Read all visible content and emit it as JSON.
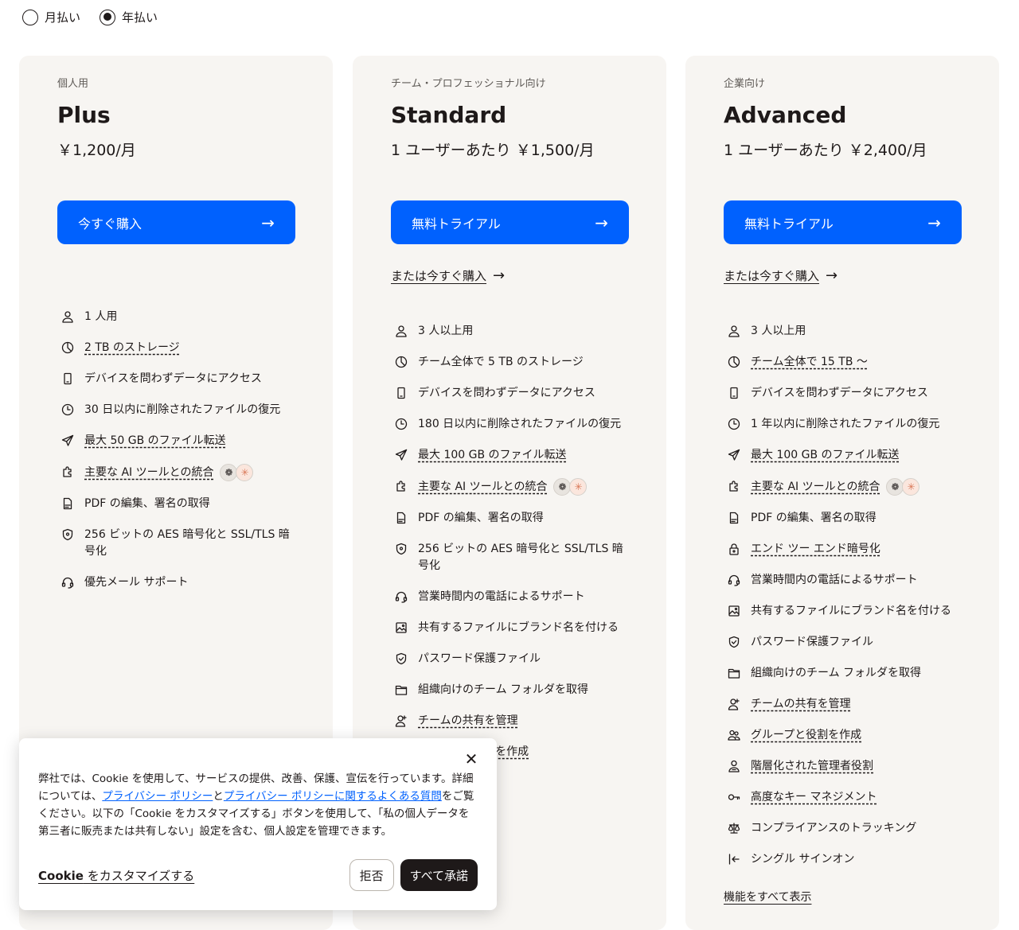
{
  "billing": {
    "monthly_label": "月払い",
    "annual_label": "年払い",
    "selected": "annual"
  },
  "plans": [
    {
      "eyebrow": "個人用",
      "name": "Plus",
      "price": "￥1,200/月",
      "cta": "今すぐ購入",
      "buy_link": "",
      "features": [
        {
          "icon": "person-icon",
          "text": "1 人用",
          "link": false
        },
        {
          "icon": "pie-chart-icon",
          "text": "2 TB のストレージ",
          "link": true
        },
        {
          "icon": "mobile-device-icon",
          "text": "デバイスを問わずデータにアクセス",
          "link": false
        },
        {
          "icon": "clock-icon",
          "text": "30 日以内に削除されたファイルの復元",
          "link": false
        },
        {
          "icon": "paper-plane-icon",
          "text": "最大 50 GB のファイル転送",
          "link": true
        },
        {
          "icon": "puzzle-icon",
          "text": "主要な AI ツールとの統合",
          "link": true,
          "ai": true
        },
        {
          "icon": "pdf-icon",
          "text": "PDF の編集、署名の取得",
          "link": false
        },
        {
          "icon": "shield-icon",
          "text": "256 ビットの AES 暗号化と SSL/TLS 暗号化",
          "link": false
        },
        {
          "icon": "headset-icon",
          "text": "優先メール サポート",
          "link": false
        }
      ]
    },
    {
      "eyebrow": "チーム・プロフェッショナル向け",
      "name": "Standard",
      "price": "1 ユーザーあたり ￥1,500/月",
      "cta": "無料トライアル",
      "buy_link": "または今すぐ購入",
      "features": [
        {
          "icon": "person-icon",
          "text": "3 人以上用",
          "link": false
        },
        {
          "icon": "pie-chart-icon",
          "text": "チーム全体で 5 TB のストレージ",
          "link": false
        },
        {
          "icon": "mobile-device-icon",
          "text": "デバイスを問わずデータにアクセス",
          "link": false
        },
        {
          "icon": "clock-icon",
          "text": "180 日以内に削除されたファイルの復元",
          "link": false
        },
        {
          "icon": "paper-plane-icon",
          "text": "最大 100 GB のファイル転送",
          "link": true
        },
        {
          "icon": "puzzle-icon",
          "text": "主要な AI ツールとの統合",
          "link": true,
          "ai": true
        },
        {
          "icon": "pdf-icon",
          "text": "PDF の編集、署名の取得",
          "link": false
        },
        {
          "icon": "shield-icon",
          "text": "256 ビットの AES 暗号化と SSL/TLS 暗号化",
          "link": false
        },
        {
          "icon": "headset-icon",
          "text": "営業時間内の電話によるサポート",
          "link": false
        },
        {
          "icon": "image-icon",
          "text": "共有するファイルにブランド名を付ける",
          "link": false
        },
        {
          "icon": "shield-check-icon",
          "text": "パスワード保護ファイル",
          "link": false
        },
        {
          "icon": "folder-icon",
          "text": "組織向けのチーム フォルダを取得",
          "link": false
        },
        {
          "icon": "person-add-icon",
          "text": "チームの共有を管理",
          "link": true
        },
        {
          "icon": "group-icon",
          "text": "グループと役割を作成",
          "link": true
        }
      ]
    },
    {
      "eyebrow": "企業向け",
      "name": "Advanced",
      "price": "1 ユーザーあたり ￥2,400/月",
      "cta": "無料トライアル",
      "buy_link": "または今すぐ購入",
      "show_all": "機能をすべて表示",
      "features": [
        {
          "icon": "person-icon",
          "text": "3 人以上用",
          "link": false
        },
        {
          "icon": "pie-chart-icon",
          "text": "チーム全体で 15 TB ～",
          "link": true
        },
        {
          "icon": "mobile-device-icon",
          "text": "デバイスを問わずデータにアクセス",
          "link": false
        },
        {
          "icon": "clock-icon",
          "text": "1 年以内に削除されたファイルの復元",
          "link": false
        },
        {
          "icon": "paper-plane-icon",
          "text": "最大 100 GB のファイル転送",
          "link": true
        },
        {
          "icon": "puzzle-icon",
          "text": "主要な AI ツールとの統合",
          "link": true,
          "ai": true
        },
        {
          "icon": "pdf-icon",
          "text": "PDF の編集、署名の取得",
          "link": false
        },
        {
          "icon": "lock-icon",
          "text": "エンド ツー エンド暗号化",
          "link": true
        },
        {
          "icon": "headset-icon",
          "text": "営業時間内の電話によるサポート",
          "link": false
        },
        {
          "icon": "image-icon",
          "text": "共有するファイルにブランド名を付ける",
          "link": false
        },
        {
          "icon": "shield-check-icon",
          "text": "パスワード保護ファイル",
          "link": false
        },
        {
          "icon": "folder-icon",
          "text": "組織向けのチーム フォルダを取得",
          "link": false
        },
        {
          "icon": "person-add-icon",
          "text": "チームの共有を管理",
          "link": true
        },
        {
          "icon": "group-icon",
          "text": "グループと役割を作成",
          "link": true
        },
        {
          "icon": "admin-icon",
          "text": "階層化された管理者役割",
          "link": true
        },
        {
          "icon": "key-icon",
          "text": "高度なキー マネジメント",
          "link": true
        },
        {
          "icon": "scale-icon",
          "text": "コンプライアンスのトラッキング",
          "link": false
        },
        {
          "icon": "sign-in-icon",
          "text": "シングル サインオン",
          "link": false
        }
      ]
    }
  ],
  "cookie": {
    "text_1": "弊社では、Cookie を使用して、サービスの提供、改善、保護、宣伝を行っています。詳細については、",
    "link_1": "プライバシー ポリシー",
    "text_2": "と",
    "link_2": "プライバシー ポリシーに関するよくある質問",
    "text_3": "をご覧ください。以下の「Cookie をカスタマイズする」ボタンを使用して、「私の個人データを第三者に販売または共有しない」設定を含む、個人設定を管理できます。",
    "customize_bold": "Cookie",
    "customize_rest": " をカスタマイズする",
    "reject": "拒否",
    "accept": "すべて承諾"
  }
}
